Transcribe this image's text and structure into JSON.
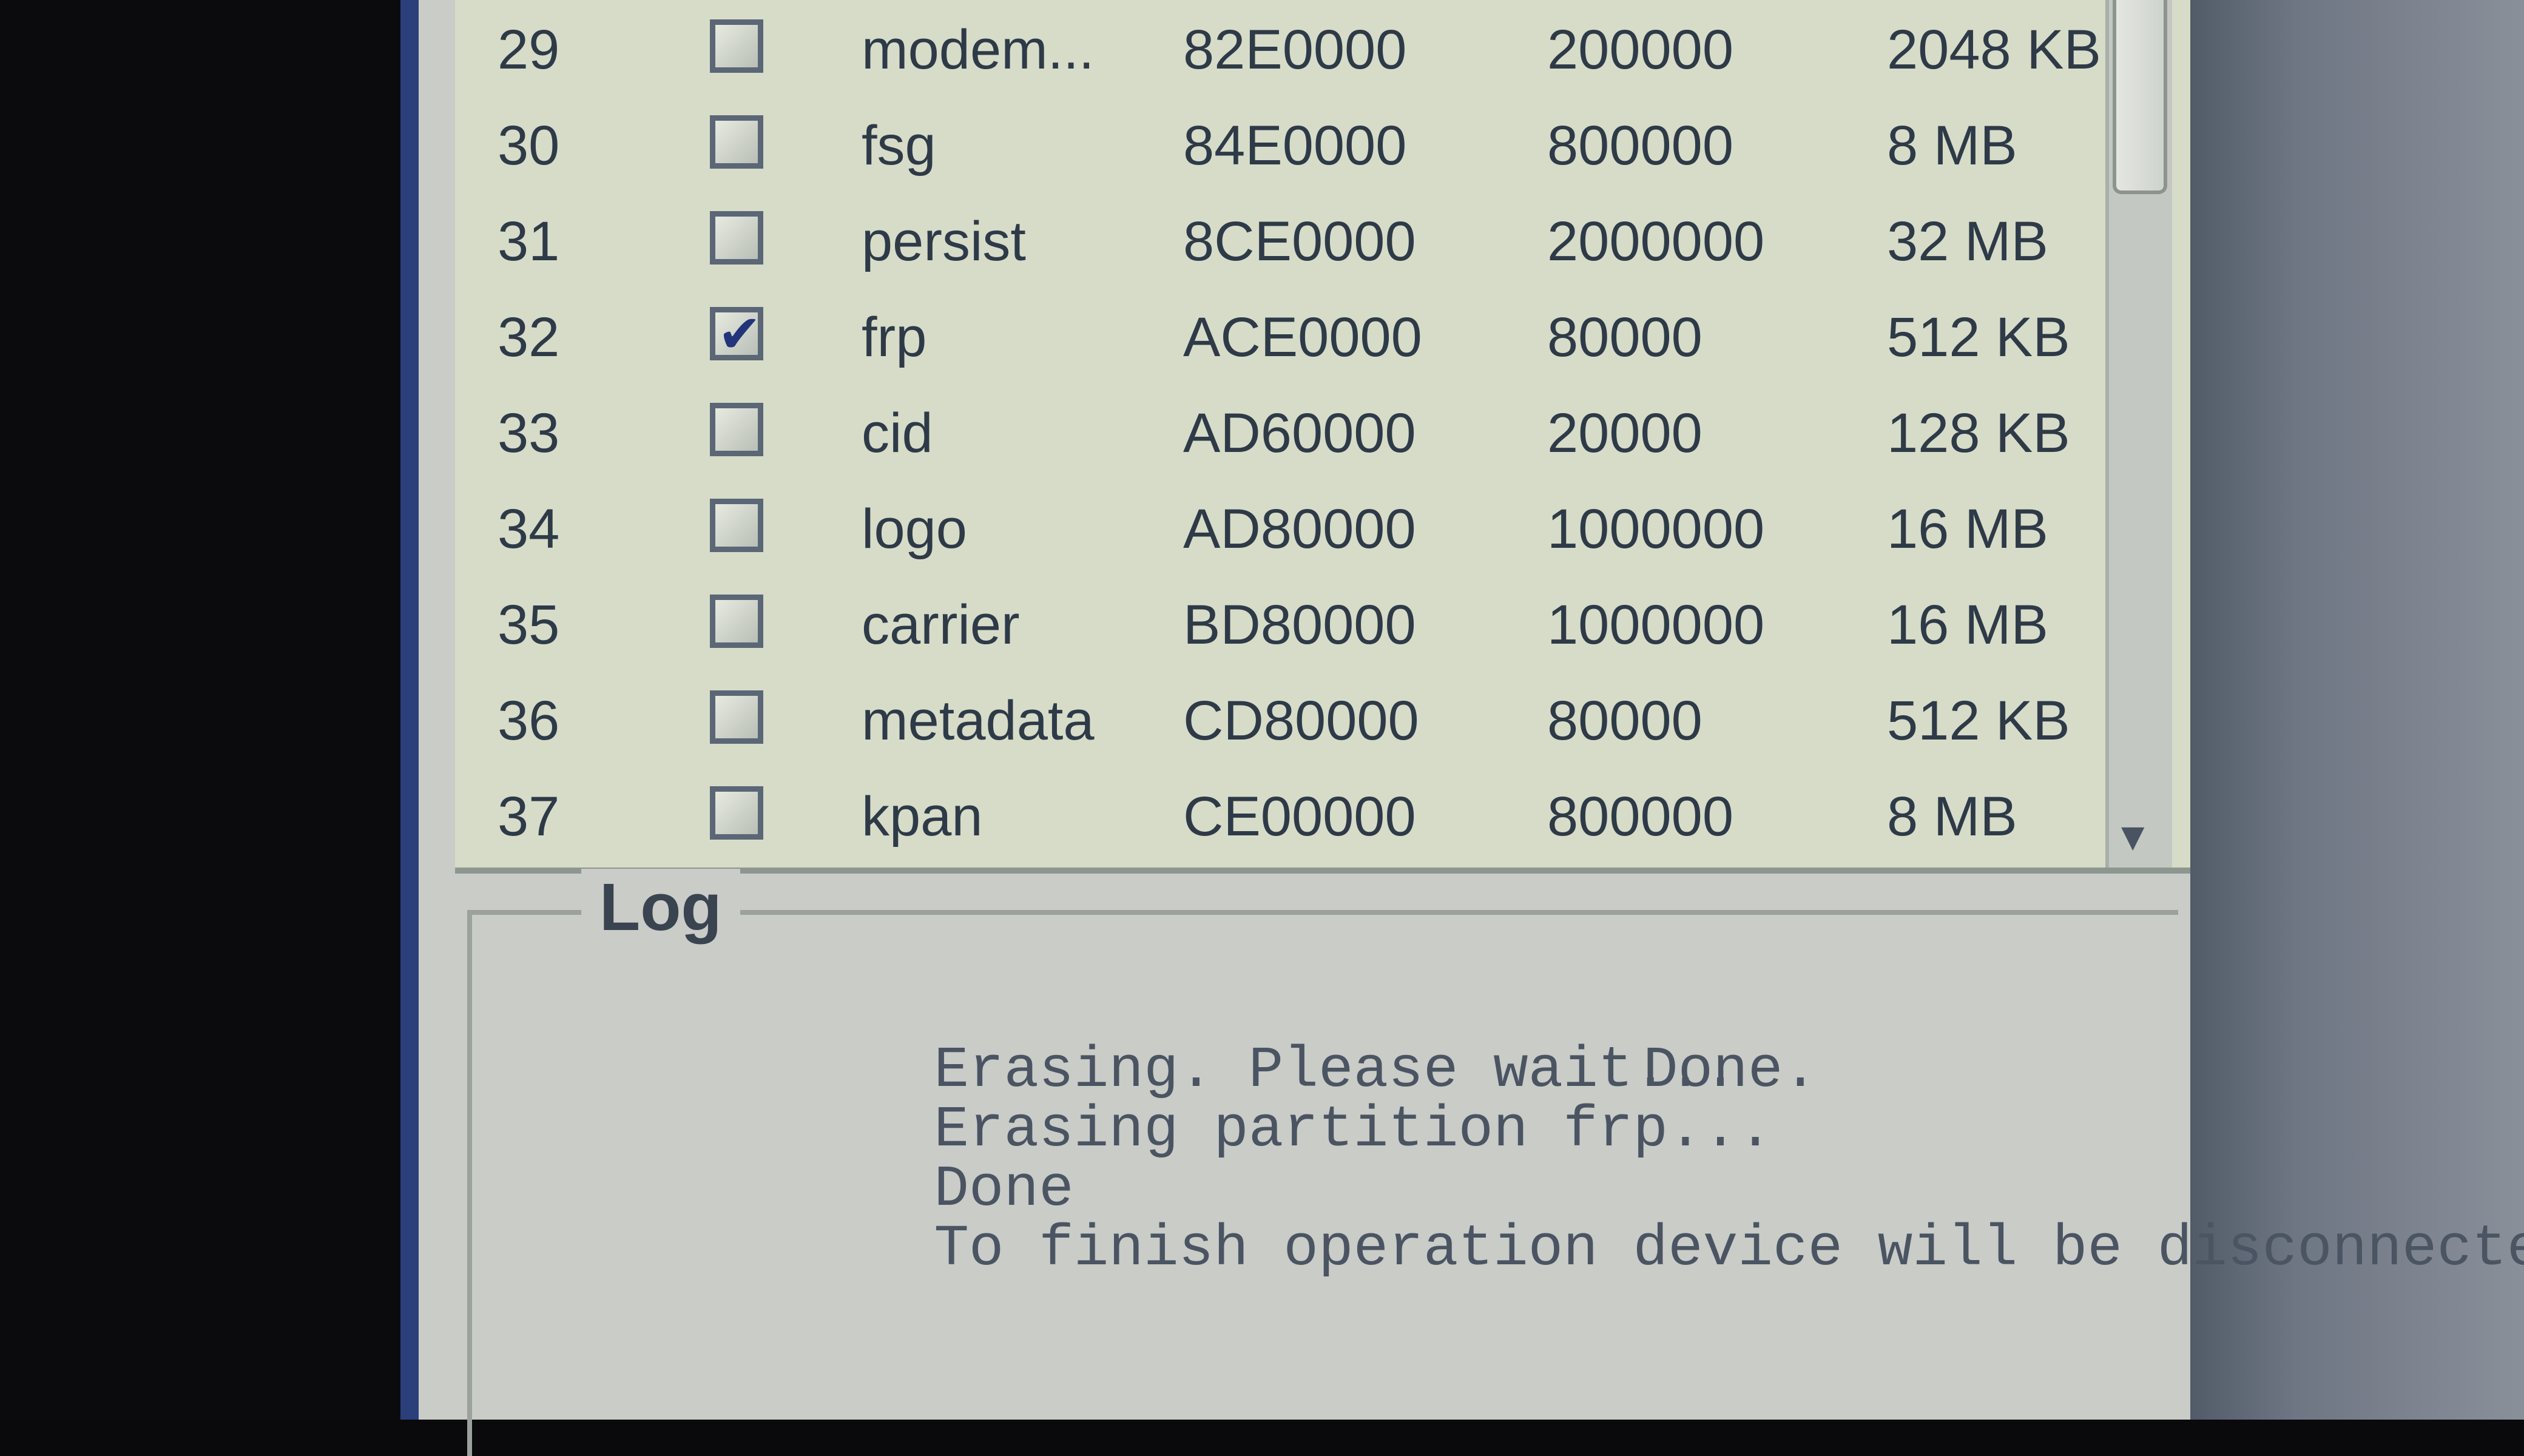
{
  "partitions": {
    "rows": [
      {
        "num": "29",
        "checked": false,
        "name": "modem...",
        "address": "82E0000",
        "length": "200000",
        "size": "2048 KB"
      },
      {
        "num": "30",
        "checked": false,
        "name": "fsg",
        "address": "84E0000",
        "length": "800000",
        "size": "8 MB"
      },
      {
        "num": "31",
        "checked": false,
        "name": "persist",
        "address": "8CE0000",
        "length": "2000000",
        "size": "32 MB"
      },
      {
        "num": "32",
        "checked": true,
        "name": "frp",
        "address": "ACE0000",
        "length": "80000",
        "size": "512 KB"
      },
      {
        "num": "33",
        "checked": false,
        "name": "cid",
        "address": "AD60000",
        "length": "20000",
        "size": "128 KB"
      },
      {
        "num": "34",
        "checked": false,
        "name": "logo",
        "address": "AD80000",
        "length": "1000000",
        "size": "16 MB"
      },
      {
        "num": "35",
        "checked": false,
        "name": "carrier",
        "address": "BD80000",
        "length": "1000000",
        "size": "16 MB"
      },
      {
        "num": "36",
        "checked": false,
        "name": "metadata",
        "address": "CD80000",
        "length": "80000",
        "size": "512 KB"
      },
      {
        "num": "37",
        "checked": false,
        "name": "kpan",
        "address": "CE00000",
        "length": "800000",
        "size": "8 MB"
      }
    ],
    "scroll_icons": {
      "down": "scroll-down-arrow-icon"
    }
  },
  "log": {
    "title": "Log",
    "lines": [
      {
        "text": "Erasing. Please wait...",
        "status": ""
      },
      {
        "text": "Erasing partition frp...",
        "status": "Done."
      },
      {
        "text": "Done",
        "status": ""
      },
      {
        "text": "To finish operation device will be disconnected.",
        "status": ""
      }
    ]
  },
  "colors": {
    "text": "#2f3a48",
    "check_mark": "#22347a",
    "table_bg": "#d6dcc8",
    "window_bg": "#c9ccc7"
  }
}
